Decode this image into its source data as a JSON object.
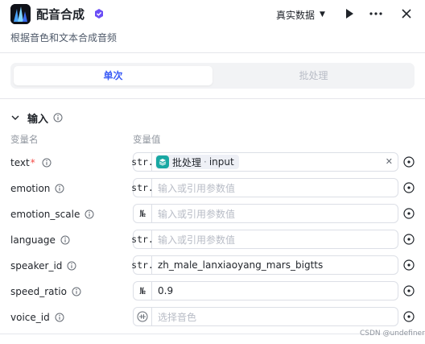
{
  "header": {
    "title": "配音合成",
    "subtitle": "根据音色和文本合成音频",
    "data_select": "真实数据"
  },
  "tabs": [
    {
      "label": "单次",
      "active": true
    },
    {
      "label": "批处理",
      "active": false
    }
  ],
  "section": {
    "title": "输入",
    "col_name": "变量名",
    "col_value": "变量值"
  },
  "fields": [
    {
      "name": "text",
      "required": true,
      "type": "str.",
      "ref": {
        "source": "批处理",
        "sep": "·",
        "field": "input"
      }
    },
    {
      "name": "emotion",
      "required": false,
      "type": "str.",
      "placeholder": "输入或引用参数值"
    },
    {
      "name": "emotion_scale",
      "required": false,
      "type": "№",
      "placeholder": "输入或引用参数值"
    },
    {
      "name": "language",
      "required": false,
      "type": "str.",
      "placeholder": "输入或引用参数值"
    },
    {
      "name": "speaker_id",
      "required": false,
      "type": "str.",
      "value": "zh_male_lanxiaoyang_mars_bigtts"
    },
    {
      "name": "speed_ratio",
      "required": false,
      "type": "№",
      "value": "0.9"
    },
    {
      "name": "voice_id",
      "required": false,
      "type": "voice-icon",
      "placeholder": "选择音色"
    }
  ],
  "watermark": "CSDN @undefiner",
  "colors": {
    "accent": "#3b5cf6",
    "ref_icon": "#18a8a3",
    "required": "#f54a45",
    "badge": "#6b4ef6"
  }
}
